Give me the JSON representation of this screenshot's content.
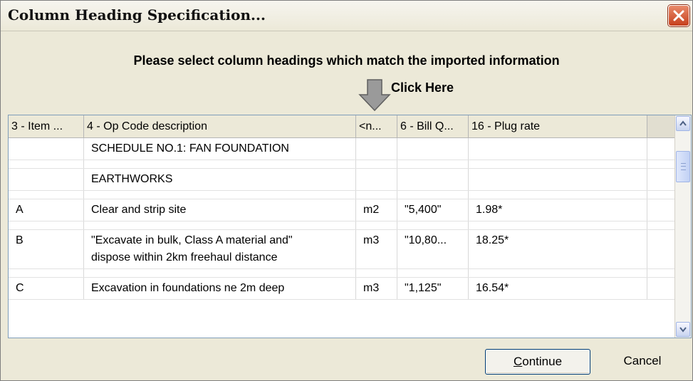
{
  "window": {
    "title": "Column Heading Specification...",
    "close_icon": "close-icon"
  },
  "instruction": "Please select column headings which match the imported information",
  "hint": {
    "label": "Click Here",
    "icon": "down-arrow-icon"
  },
  "columns": [
    {
      "label": "3 - Item ..."
    },
    {
      "label": "4 - Op Code description"
    },
    {
      "label": "<n..."
    },
    {
      "label": "6 - Bill Q..."
    },
    {
      "label": "16 - Plug rate"
    },
    {
      "label": ""
    }
  ],
  "rows": [
    {
      "cells": [
        "",
        "SCHEDULE NO.1: FAN FOUNDATION",
        "",
        "",
        "",
        ""
      ]
    },
    {
      "cells": [
        "",
        "",
        "",
        "",
        "",
        ""
      ]
    },
    {
      "cells": [
        "",
        "EARTHWORKS",
        "",
        "",
        "",
        ""
      ]
    },
    {
      "cells": [
        "",
        "",
        "",
        "",
        "",
        ""
      ]
    },
    {
      "cells": [
        "A",
        "Clear and strip site",
        "m2",
        "\"5,400\"",
        "1.98*",
        ""
      ]
    },
    {
      "cells": [
        "",
        "",
        "",
        "",
        "",
        ""
      ]
    },
    {
      "cells": [
        "B",
        "\"Excavate in bulk, Class A material and\"",
        "m3",
        "\"10,80...",
        "18.25*",
        ""
      ]
    },
    {
      "cells": [
        "",
        "dispose within 2km freehaul distance",
        "",
        "",
        "",
        ""
      ]
    },
    {
      "cells": [
        "",
        "",
        "",
        "",
        "",
        ""
      ]
    },
    {
      "cells": [
        "C",
        "Excavation in foundations ne 2m deep",
        "m3",
        "\"1,125\"",
        "16.54*",
        ""
      ]
    }
  ],
  "buttons": {
    "continue_underline": "C",
    "continue_rest": "ontinue",
    "cancel": "Cancel"
  },
  "colors": {
    "dialog_bg": "#ece9d8",
    "close_button": "#c6401d",
    "grid_border": "#7f9db9"
  }
}
